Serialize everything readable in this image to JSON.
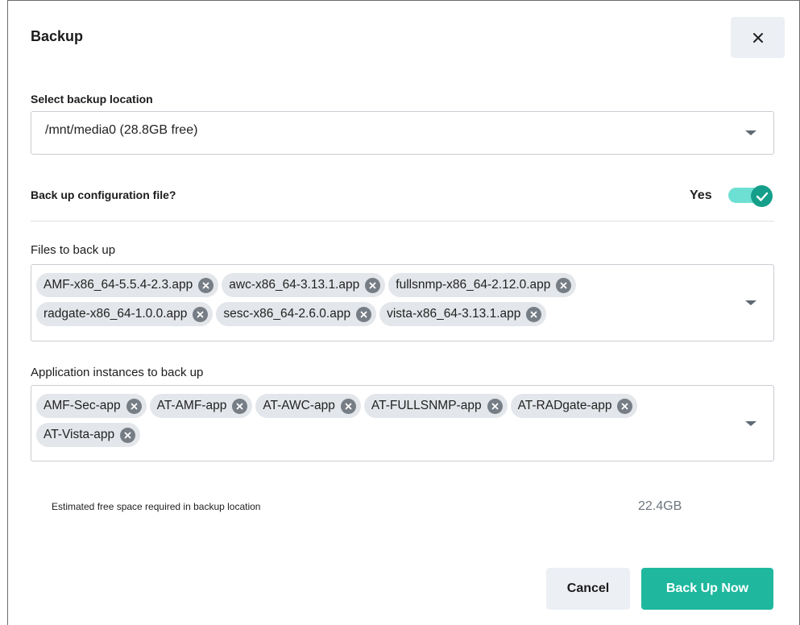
{
  "dialog": {
    "title": "Backup",
    "close_icon": "close-icon"
  },
  "location": {
    "label": "Select backup location",
    "selected": "/mnt/media0 (28.8GB free)"
  },
  "config": {
    "label": "Back up configuration file?",
    "toggle_text": "Yes",
    "toggle_on": true,
    "accent_color": "#159f8a"
  },
  "files": {
    "label": "Files to back up",
    "items": [
      "AMF-x86_64-5.5.4-2.3.app",
      "awc-x86_64-3.13.1.app",
      "fullsnmp-x86_64-2.12.0.app",
      "radgate-x86_64-1.0.0.app",
      "sesc-x86_64-2.6.0.app",
      "vista-x86_64-3.13.1.app"
    ]
  },
  "instances": {
    "label": "Application instances to back up",
    "items": [
      "AMF-Sec-app",
      "AT-AMF-app",
      "AT-AWC-app",
      "AT-FULLSNMP-app",
      "AT-RADgate-app",
      "AT-Vista-app"
    ]
  },
  "estimate": {
    "label": "Estimated free space required in backup location",
    "value": "22.4GB"
  },
  "actions": {
    "cancel_label": "Cancel",
    "primary_label": "Back Up Now",
    "primary_color": "#1fb89e"
  }
}
